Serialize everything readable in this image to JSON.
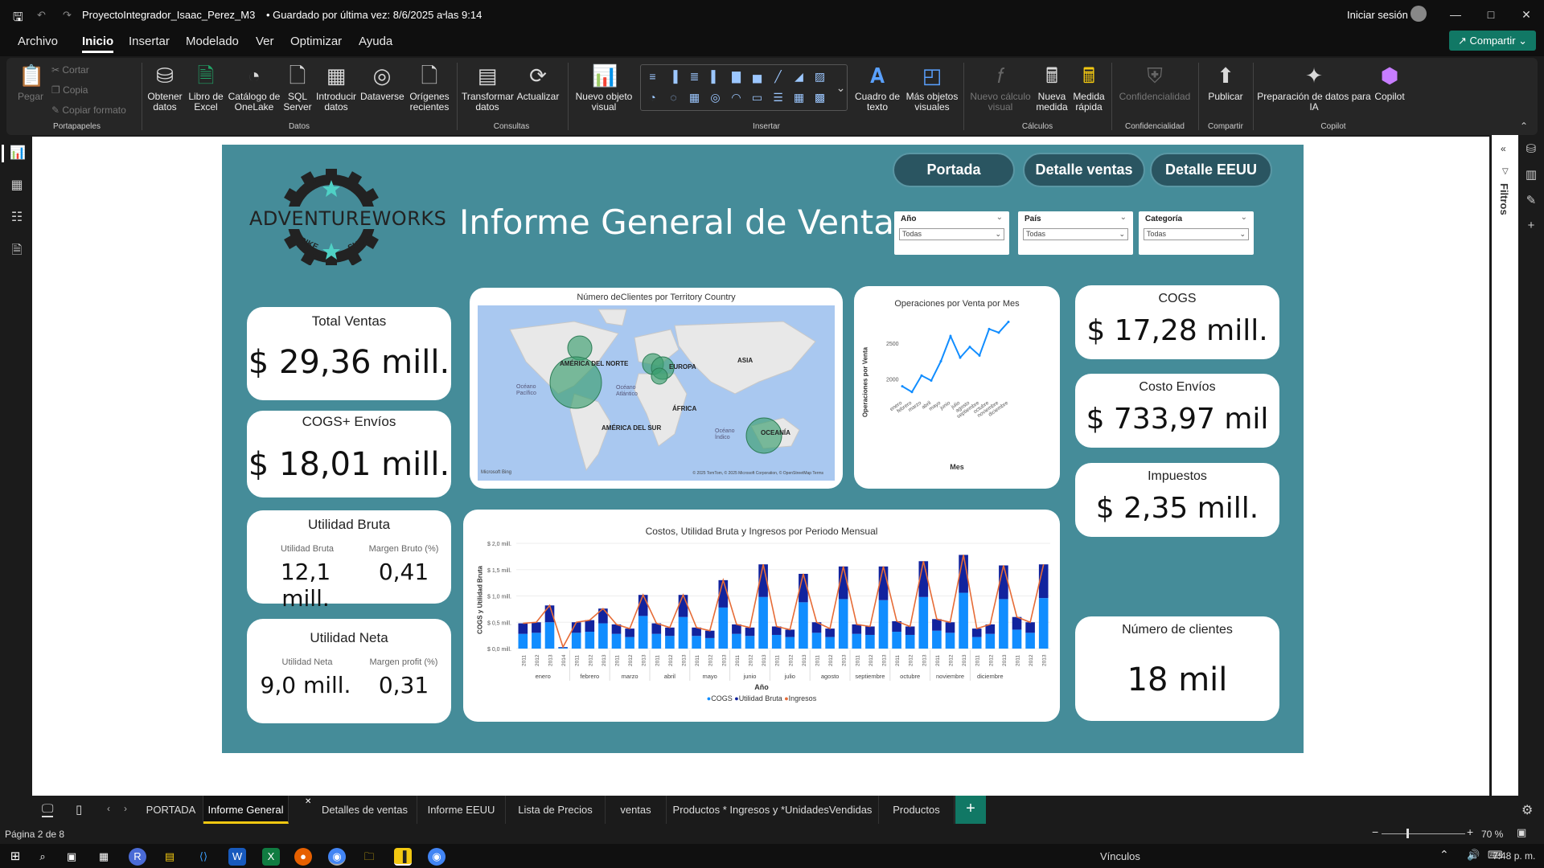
{
  "titlebar": {
    "doc_title": "ProyectoIntegrador_Isaac_Perez_M3",
    "saved_text": "• Guardado por última vez: 8/6/2025 a las 9:14",
    "signin": "Iniciar sesión"
  },
  "menu": [
    "Archivo",
    "Inicio",
    "Insertar",
    "Modelado",
    "Ver",
    "Optimizar",
    "Ayuda"
  ],
  "share_label": "Compartir",
  "ribbon": {
    "portapapeles": {
      "paste": "Pegar",
      "cut": "Cortar",
      "copy": "Copia",
      "format": "Copiar formato",
      "group": "Portapapeles"
    },
    "datos": {
      "obtener": "Obtener datos",
      "excel": "Libro de Excel",
      "onelake": "Catálogo de OneLake",
      "sql": "SQL Server",
      "introducir": "Introducir datos",
      "dataverse": "Dataverse",
      "origenes": "Orígenes recientes",
      "group": "Datos"
    },
    "consultas": {
      "transformar": "Transformar datos",
      "actualizar": "Actualizar",
      "group": "Consultas"
    },
    "insertar": {
      "nuevo": "Nuevo objeto visual",
      "cuadro": "Cuadro de texto",
      "mas": "Más objetos visuales",
      "group": "Insertar"
    },
    "calculos": {
      "calculo": "Nuevo cálculo visual",
      "medida": "Nueva medida",
      "rapida": "Medida rápida",
      "group": "Cálculos"
    },
    "confidencialidad": {
      "label": "Confidencialidad",
      "group": "Confidencialidad"
    },
    "compartir": {
      "publicar": "Publicar",
      "group": "Compartir"
    },
    "copilot": {
      "prep": "Preparación de datos para IA",
      "copilot": "Copilot",
      "group": "Copilot"
    }
  },
  "right_pane": {
    "filtros": "Filtros"
  },
  "report": {
    "title": "Informe General de Ventas",
    "logo_text": "ADVENTUREWORKS",
    "logo_sub1": "BIKE",
    "logo_sub2": "SHOP",
    "nav": [
      "Portada",
      "Detalle ventas",
      "Detalle EEUU"
    ],
    "slicers": [
      {
        "label": "Año",
        "value": "Todas"
      },
      {
        "label": "País",
        "value": "Todas"
      },
      {
        "label": "Categoría",
        "value": "Todas"
      }
    ],
    "cards": {
      "total_ventas": {
        "title": "Total Ventas",
        "value": "$ 29,36 mill."
      },
      "cogs_envios": {
        "title": "COGS+ Envíos",
        "value": "$ 18,01 mill."
      },
      "cogs": {
        "title": "COGS",
        "value": "$ 17,28 mill."
      },
      "costo_envios": {
        "title": "Costo Envíos",
        "value": "$ 733,97 mil"
      },
      "impuestos": {
        "title": "Impuestos",
        "value": "$ 2,35 mill."
      },
      "num_clientes": {
        "title": "Número de clientes",
        "value": "18 mil"
      }
    },
    "utilidad_bruta": {
      "title": "Utilidad Bruta",
      "sub1": "Utilidad Bruta",
      "val1": "12,1 mill.",
      "sub2": "Margen Bruto (%)",
      "val2": "0,41"
    },
    "utilidad_neta": {
      "title": "Utilidad Neta",
      "sub1": "Utilidad Neta",
      "val1": "9,0 mill.",
      "sub2": "Margen profit (%)",
      "val2": "0,31"
    },
    "map": {
      "title": "Número deClientes por Territory Country",
      "labels": [
        "AMÉRICA DEL NORTE",
        "EUROPA",
        "ASIA",
        "ÁFRICA",
        "AMÉRICA DEL SUR",
        "OCEANÍA",
        "Océano Pacífico",
        "Océano Atlántico",
        "Océano Índico"
      ],
      "footer_left": "Microsoft Bing",
      "footer_right": "© 2025 TomTom, © 2025 Microsoft Corporation, © OpenStreetMap  Terms"
    }
  },
  "chart_data": [
    {
      "type": "line",
      "title": "Operaciones por Venta por Mes",
      "xlabel": "Mes",
      "ylabel": "Operaciones por Venta",
      "categories": [
        "enero",
        "febrero",
        "marzo",
        "abril",
        "mayo",
        "junio",
        "julio",
        "agosto",
        "septiembre",
        "octubre",
        "noviembre",
        "diciembre"
      ],
      "values": [
        1900,
        1820,
        2050,
        1980,
        2250,
        2600,
        2300,
        2450,
        2330,
        2700,
        2650,
        2800
      ],
      "yticks": [
        2000,
        2500
      ],
      "ylim": [
        1750,
        2850
      ]
    },
    {
      "type": "bar",
      "title": "Costos, Utilidad Bruta y Ingresos por Periodo Mensual",
      "xlabel": "Año",
      "ylabel": "COGS y Utilidad Bruta",
      "months": [
        "enero",
        "febrero",
        "marzo",
        "abril",
        "mayo",
        "junio",
        "julio",
        "agosto",
        "septiembre",
        "octubre",
        "noviembre",
        "diciembre"
      ],
      "years": [
        "2011",
        "2012",
        "2013",
        "2014",
        "2011",
        "2012",
        "2013",
        "2011",
        "2012",
        "2013",
        "2011",
        "2012",
        "2013",
        "2011",
        "2012",
        "2013",
        "2011",
        "2012",
        "2013",
        "2011",
        "2012",
        "2013",
        "2011",
        "2012",
        "2013",
        "2011",
        "2012",
        "2013",
        "2011",
        "2012",
        "2013",
        "2011",
        "2012",
        "2013",
        "2011",
        "2012",
        "2013",
        "2011",
        "2012",
        "2013"
      ],
      "month_spans": [
        4,
        3,
        3,
        3,
        3,
        3,
        3,
        3,
        3,
        3,
        3,
        3
      ],
      "yticks": [
        "$ 0,0 mill.",
        "$ 0,5 mill.",
        "$ 1,0 mill.",
        "$ 1,5 mill.",
        "$ 2,0 mill."
      ],
      "ylim": [
        0,
        2.0
      ],
      "series": [
        {
          "name": "COGS",
          "color": "#118dff",
          "values": [
            0.28,
            0.3,
            0.5,
            0.02,
            0.3,
            0.32,
            0.48,
            0.28,
            0.22,
            0.62,
            0.28,
            0.24,
            0.6,
            0.24,
            0.2,
            0.78,
            0.28,
            0.24,
            0.98,
            0.26,
            0.22,
            0.88,
            0.3,
            0.22,
            0.94,
            0.28,
            0.26,
            0.92,
            0.32,
            0.26,
            0.98,
            0.34,
            0.3,
            1.06,
            0.22,
            0.28,
            0.94,
            0.36,
            0.3,
            0.96
          ]
        },
        {
          "name": "Utilidad Bruta",
          "color": "#12239e",
          "values": [
            0.2,
            0.2,
            0.32,
            0.01,
            0.2,
            0.22,
            0.28,
            0.18,
            0.16,
            0.4,
            0.2,
            0.16,
            0.42,
            0.16,
            0.14,
            0.52,
            0.18,
            0.16,
            0.62,
            0.16,
            0.14,
            0.54,
            0.2,
            0.16,
            0.62,
            0.18,
            0.16,
            0.64,
            0.2,
            0.16,
            0.68,
            0.22,
            0.2,
            0.72,
            0.16,
            0.18,
            0.64,
            0.24,
            0.2,
            0.64
          ]
        },
        {
          "name": "Ingresos",
          "color": "#e66c37",
          "values": [
            0.48,
            0.5,
            0.82,
            0.03,
            0.5,
            0.54,
            0.76,
            0.46,
            0.38,
            1.02,
            0.48,
            0.4,
            1.02,
            0.4,
            0.34,
            1.3,
            0.46,
            0.4,
            1.6,
            0.42,
            0.36,
            1.42,
            0.5,
            0.38,
            1.56,
            0.46,
            0.42,
            1.56,
            0.52,
            0.42,
            1.66,
            0.56,
            0.5,
            1.78,
            0.38,
            0.46,
            1.58,
            0.6,
            0.5,
            1.6
          ]
        }
      ]
    }
  ],
  "tabs": [
    "PORTADA",
    "Informe General",
    "Detalles de ventas",
    "Informe EEUU",
    "Lista de Precios",
    "ventas",
    "Productos * Ingresos y *UnidadesVendidas",
    "Productos"
  ],
  "status": {
    "page": "Página 2 de 8",
    "zoom": "70 %"
  },
  "taskbar": {
    "vinculos": "Vínculos",
    "time": "7:48 p. m."
  }
}
